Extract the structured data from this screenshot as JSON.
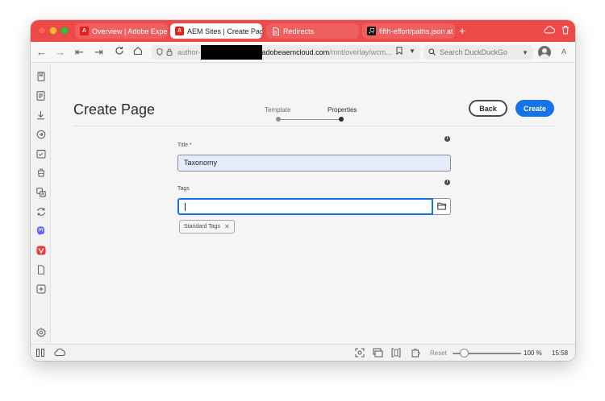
{
  "browser": {
    "tabs": [
      {
        "label": "Overview | Adobe Experier",
        "favicon": "adobe-icon",
        "active": false
      },
      {
        "label": "AEM Sites | Create Page",
        "favicon": "adobe-icon",
        "active": true
      },
      {
        "label": "Redirects",
        "favicon": "document-icon",
        "active": false
      },
      {
        "label": "fifth-effort/paths.json at m",
        "favicon": "github-icon",
        "active": false
      }
    ],
    "url": {
      "prefix": "author-",
      "host": "adobeaemcloud.com",
      "path": "/mnt/overlay/wcm..."
    },
    "search_placeholder": "Search DuckDuckGo",
    "reader_label": "A"
  },
  "page": {
    "title": "Create Page",
    "wizard": {
      "steps": [
        "Template",
        "Properties"
      ],
      "active_step": 1
    },
    "back_label": "Back",
    "create_label": "Create"
  },
  "form": {
    "title_label": "Title *",
    "title_value": "Taxonomy",
    "tags_label": "Tags",
    "tags_value": "",
    "tag_chips": [
      "Standard Tags"
    ]
  },
  "statusbar": {
    "reset_label": "Reset",
    "zoom": "100 %",
    "zoom_fraction": 0.17,
    "time": "15:58"
  },
  "colors": {
    "tabbar": "#ee4949",
    "accent": "#1473e6",
    "title_field": "#e4ecfb"
  }
}
